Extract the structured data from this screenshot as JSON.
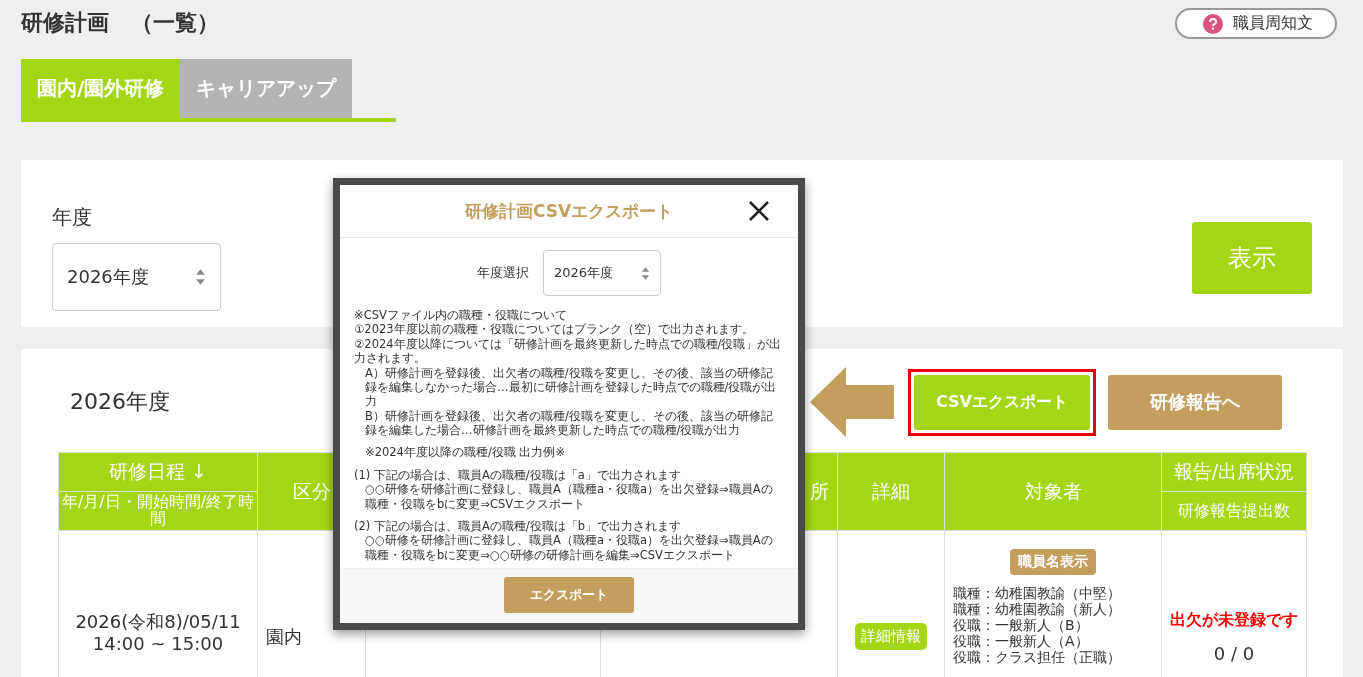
{
  "page_title": "研修計画　（一覧）",
  "help_button": "職員周知文",
  "tabs": [
    {
      "label": "園内/園外研修",
      "selected": true
    },
    {
      "label": "キャリアアップ",
      "selected": false
    }
  ],
  "filter": {
    "label": "年度",
    "year": "2026年度",
    "button": "表示"
  },
  "list": {
    "heading": "2026年度",
    "buttons": [
      {
        "label": "CSVエクスポート",
        "kind": "export",
        "highlighted": true
      },
      {
        "label": "研修報告へ",
        "kind": "report",
        "highlighted": false
      }
    ]
  },
  "table": {
    "columns": [
      {
        "label": "研修日程 ↓",
        "sub": "年/月/日・開始時間/終了時間"
      },
      {
        "label": "区分"
      },
      {},
      {
        "label": "所"
      },
      {
        "label": "詳細"
      },
      {
        "label": "対象者"
      },
      {
        "label": "報告/出席状況",
        "sub": "研修報告提出数"
      }
    ],
    "rows": [
      {
        "date": "2026(令和8)/05/11",
        "time": "14:00 ~ 15:00",
        "category": "園内",
        "detail_button": "詳細情報",
        "staff_button": "職員名表示",
        "targets": [
          "職種：幼稚園教諭（中堅）",
          "職種：幼稚園教諭（新人）",
          "役職：一般新人（B）",
          "役職：一般新人（A）",
          "役職：クラス担任（正職）"
        ],
        "status": "出欠が未登録です",
        "count": "0 / 0"
      }
    ]
  },
  "modal": {
    "title": "研修計画CSVエクスポート",
    "year_label": "年度選択",
    "year": "2026年度",
    "notes": [
      [
        {
          "text": "※CSVファイル内の職種・役職について",
          "kind": "line"
        },
        {
          "text": "①2023年度以前の職種・役職についてはブランク（空）で出力されます。",
          "kind": "line"
        },
        {
          "text": "②2024年度以降については「研修計画を最終更新した時点での職種/役職」が出力されます。",
          "kind": "line"
        },
        {
          "text": "A）研修計画を登録後、出欠者の職種/役職を変更し、その後、該当の研修記録を編集しなかった場合…最初に研修計画を登録した時点での職種/役職が出力",
          "kind": "indent"
        },
        {
          "text": "B）研修計画を登録後、出欠者の職種/役職を変更し、その後、該当の研修記録を編集した場合…研修計画を最終更新した時点での職種/役職が出力",
          "kind": "indent"
        }
      ],
      [
        {
          "text": "※2024年度以降の職種/役職 出力例※",
          "kind": "indent"
        }
      ],
      [
        {
          "text": "(1) 下記の場合は、職員Aの職種/役職は「a」で出力されます",
          "kind": "line"
        },
        {
          "text": "○○研修を研修計画に登録し、職員A（職種a・役職a）を出欠登録⇒職員Aの職種・役職をbに変更⇒CSVエクスポート",
          "kind": "indent"
        }
      ],
      [
        {
          "text": "(2) 下記の場合は、職員Aの職種/役職は「b」で出力されます",
          "kind": "line"
        },
        {
          "text": "○○研修を研修計画に登録し、職員A（職種a・役職a）を出欠登録⇒職員Aの職種・役職をbに変更⇒○○研修の研修計画を編集⇒CSVエクスポート",
          "kind": "indent"
        }
      ]
    ],
    "button": "エクスポート"
  }
}
